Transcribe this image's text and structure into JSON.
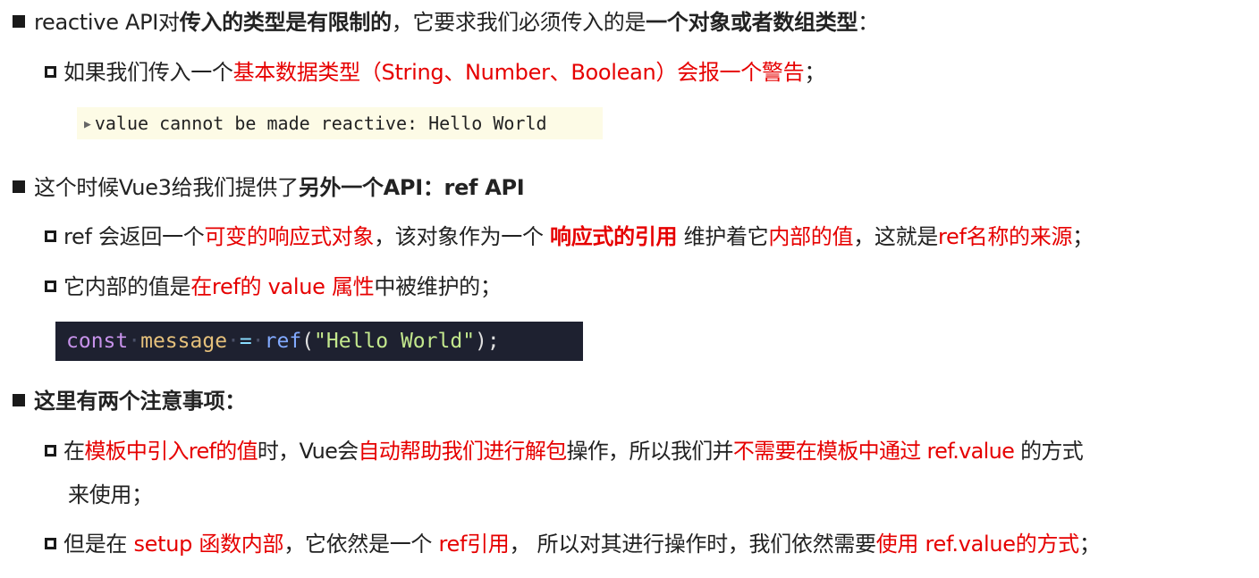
{
  "section1": {
    "title_parts": [
      "reactive API对",
      "传入的类型是有限制的",
      "，它要求我们必须传入的是",
      "一个对象或者数组类型",
      "："
    ],
    "item1_parts": [
      "如果我们传入一个",
      "基本数据类型（String、Number、Boolean）会报一个警告",
      "；"
    ],
    "warning_code": "value cannot be made reactive: Hello World"
  },
  "section2": {
    "title_parts": [
      "这个时候Vue3给我们提供了",
      "另外一个API：ref API"
    ],
    "item1_parts": [
      "ref 会返回一个",
      "可变的响应式对象",
      "，该对象作为一个 ",
      "响应式的引用",
      " 维护着它",
      "内部的值",
      "，这就是",
      "ref名称的来源",
      "；"
    ],
    "item2_parts": [
      "它内部的值是",
      "在ref的 value 属性",
      "中被维护的；"
    ],
    "code": {
      "keyword": "const",
      "variable": "message",
      "operator": "=",
      "function": "ref",
      "open_paren": "(",
      "string": "\"Hello World\"",
      "close": ");"
    }
  },
  "section3": {
    "title": "这里有两个注意事项：",
    "item1_parts": [
      "在",
      "模板中引入ref的值",
      "时，Vue会",
      "自动帮助我们进行解包",
      "操作，所以我们并",
      "不需要在模板中通过 ref.value",
      " 的方式"
    ],
    "item1_cont": "来使用；",
    "item2_parts": [
      "但是在 ",
      "setup 函数内部",
      "，它依然是一个 ",
      "ref引用",
      "， 所以对其进行操作时，我们依然需要",
      "使用 ref.value的方式",
      "；"
    ]
  }
}
